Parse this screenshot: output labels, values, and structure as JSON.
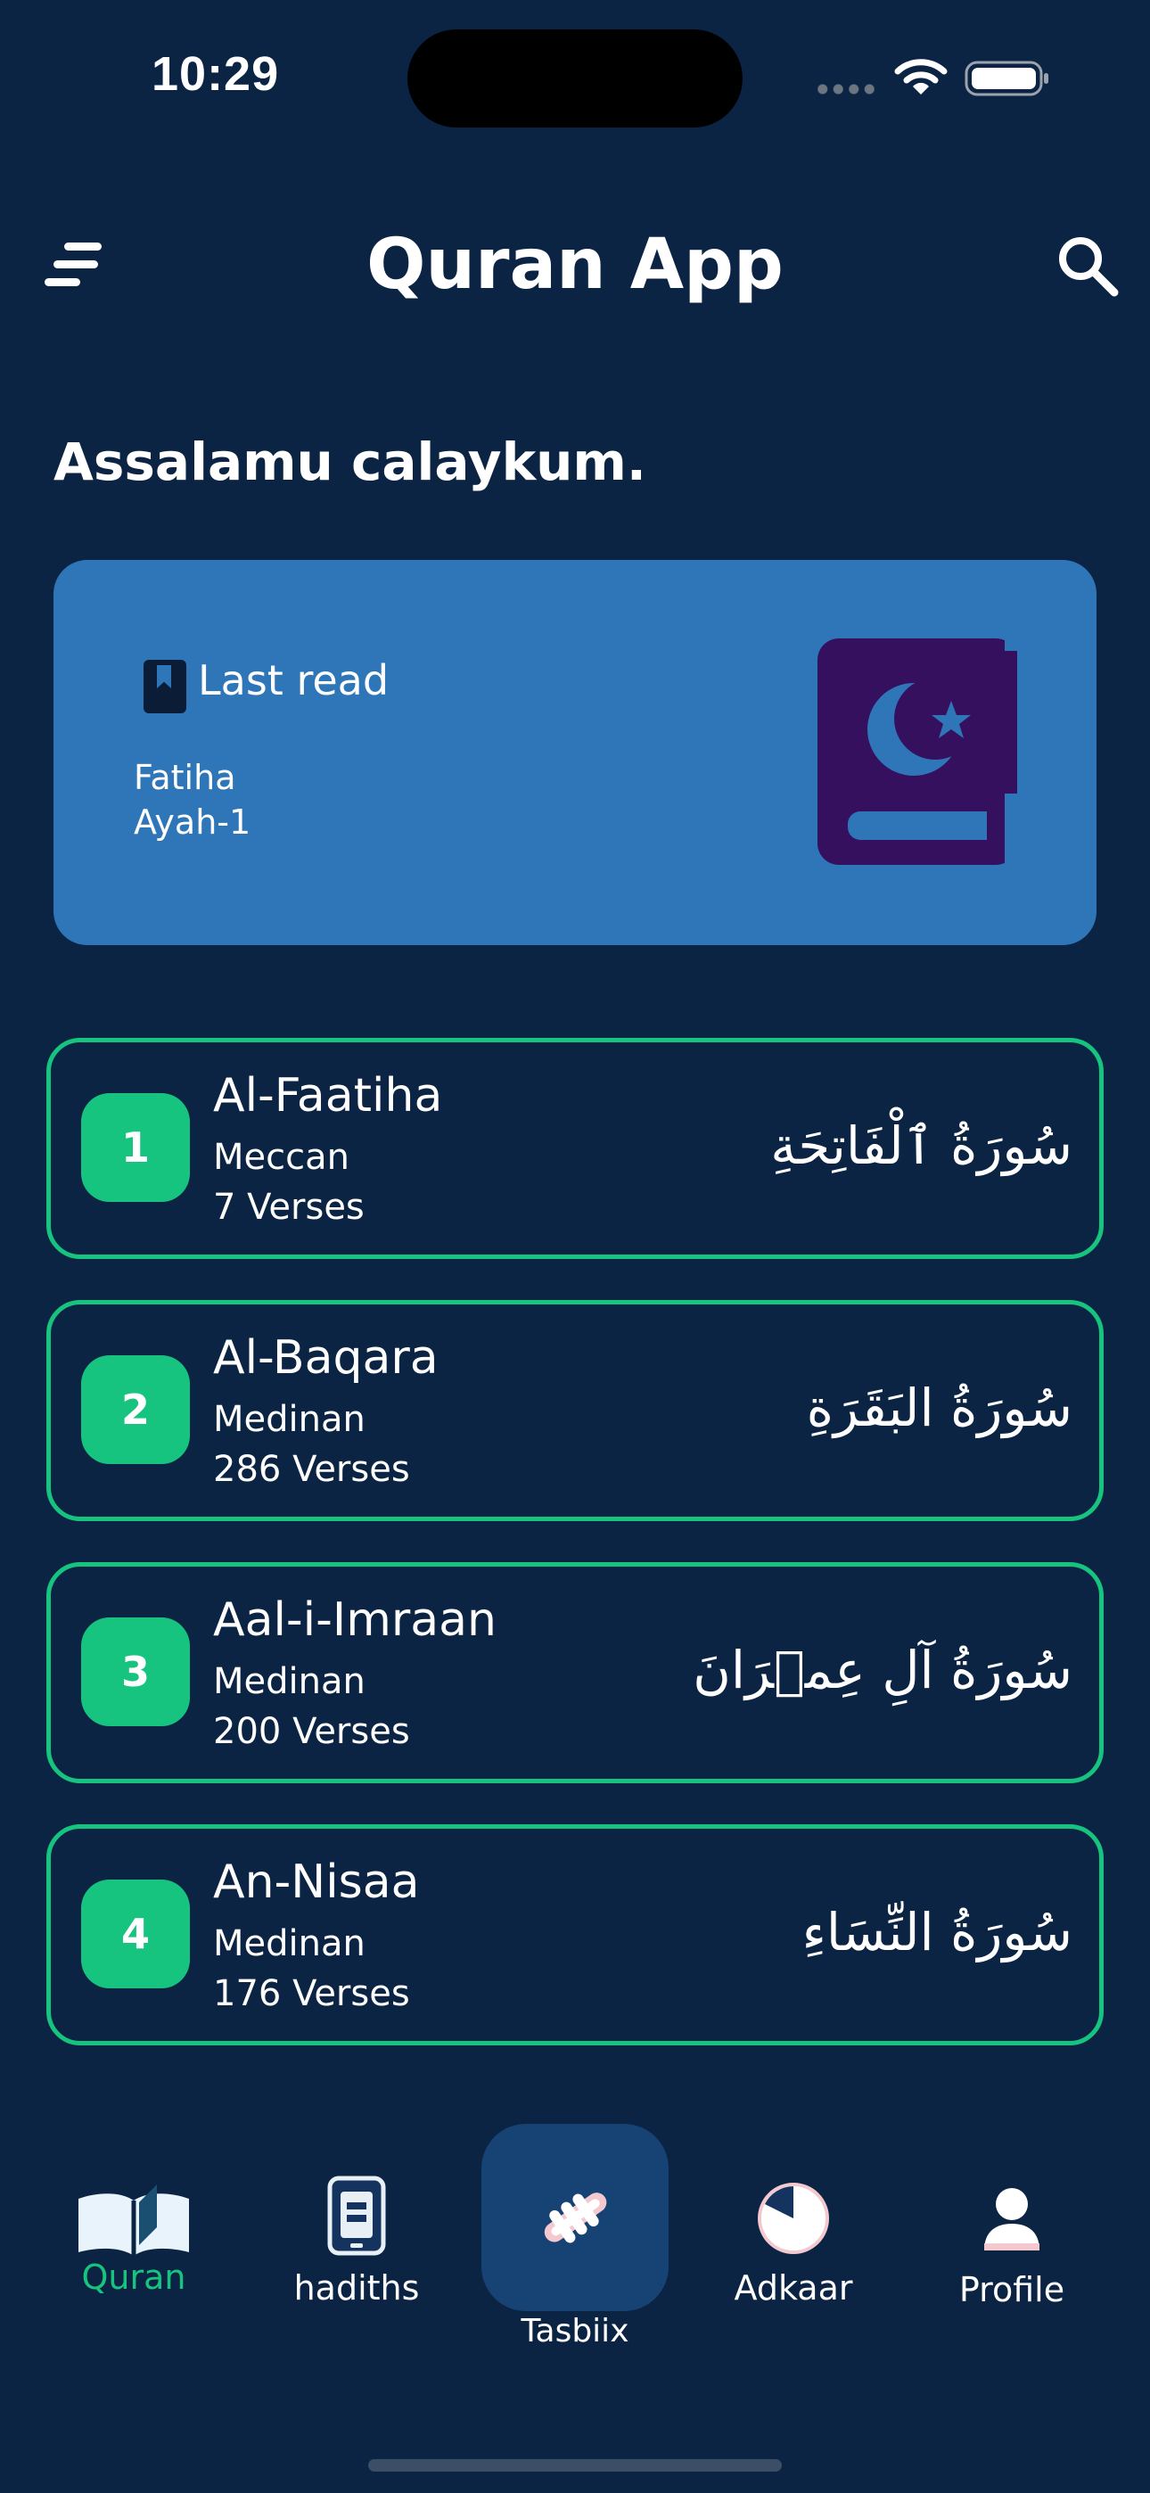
{
  "status_bar": {
    "time": "10:29"
  },
  "header": {
    "title": "Quran App"
  },
  "greeting": "Assalamu calaykum.",
  "last_read": {
    "label": "Last read",
    "surah": "Fatiha",
    "ayah": "Ayah-1"
  },
  "surahs": [
    {
      "number": "1",
      "name": "Al-Faatiha",
      "type": "Meccan",
      "verses": "7 Verses",
      "arabic": "سُورَةُ ٱلْفَاتِحَةِ"
    },
    {
      "number": "2",
      "name": "Al-Baqara",
      "type": "Medinan",
      "verses": "286 Verses",
      "arabic": "سُورَةُ البَقَرَةِ"
    },
    {
      "number": "3",
      "name": "Aal-i-Imraan",
      "type": "Medinan",
      "verses": "200 Verses",
      "arabic": "سُورَةُ آلِ عِمۡرَانَ"
    },
    {
      "number": "4",
      "name": "An-Nisaa",
      "type": "Medinan",
      "verses": "176 Verses",
      "arabic": "سُورَةُ النِّسَاءِ"
    }
  ],
  "bottom_nav": {
    "active": "quran",
    "items": [
      {
        "key": "quran",
        "label": "Quran",
        "icon": "open-book-icon"
      },
      {
        "key": "hadiths",
        "label": "hadiths",
        "icon": "phone-book-icon"
      },
      {
        "key": "tasbiix",
        "label": "Tasbiix",
        "icon": "handshake-icon"
      },
      {
        "key": "adkaar",
        "label": "Adkaar",
        "icon": "pie-timer-icon"
      },
      {
        "key": "profile",
        "label": "Profile",
        "icon": "person-icon"
      }
    ]
  },
  "colors": {
    "background": "#0b2444",
    "card": "#2f76b8",
    "accent_green": "#17c47f",
    "nav_highlight": "#164274",
    "book_purple": "#35105f"
  }
}
